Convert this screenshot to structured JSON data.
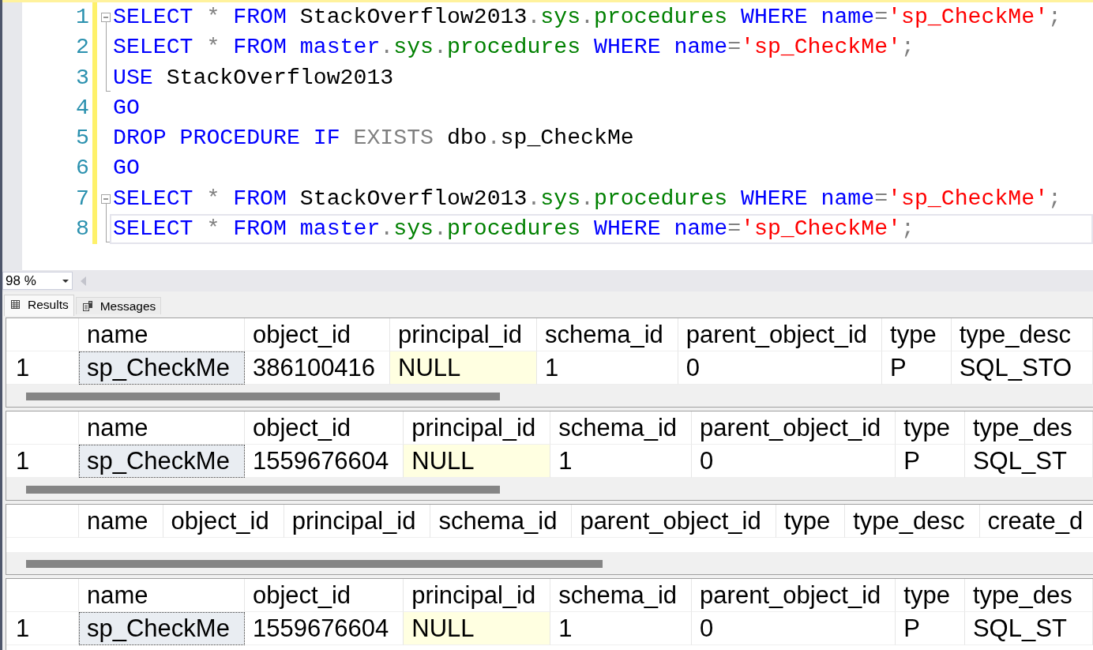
{
  "editor": {
    "lines": [
      {
        "number": "1",
        "changed": true,
        "current": false,
        "expanded": true,
        "words": [
          [
            {
              "text": "SELECT",
              "kind": "keyword"
            }
          ],
          [
            {
              "text": "*",
              "kind": "operator"
            }
          ],
          [
            {
              "text": "FROM",
              "kind": "keyword"
            }
          ],
          [
            {
              "text": "StackOverflow2013",
              "kind": "identifier"
            },
            {
              "text": ".",
              "kind": "operator"
            },
            {
              "text": "sys",
              "kind": "system"
            },
            {
              "text": ".",
              "kind": "operator"
            },
            {
              "text": "procedures",
              "kind": "system"
            }
          ],
          [
            {
              "text": "WHERE",
              "kind": "keyword"
            }
          ],
          [
            {
              "text": "name",
              "kind": "keyword"
            },
            {
              "text": "=",
              "kind": "operator"
            },
            {
              "text": "'sp_CheckMe'",
              "kind": "string"
            },
            {
              "text": ";",
              "kind": "operator"
            }
          ]
        ],
        "children": [
          {
            "number": "2",
            "changed": true,
            "current": false,
            "words": [
              [
                {
                  "text": "SELECT",
                  "kind": "keyword"
                }
              ],
              [
                {
                  "text": "*",
                  "kind": "operator"
                }
              ],
              [
                {
                  "text": "FROM",
                  "kind": "keyword"
                }
              ],
              [
                {
                  "text": "master",
                  "kind": "keyword"
                },
                {
                  "text": ".",
                  "kind": "operator"
                },
                {
                  "text": "sys",
                  "kind": "system"
                },
                {
                  "text": ".",
                  "kind": "operator"
                },
                {
                  "text": "procedures",
                  "kind": "system"
                }
              ],
              [
                {
                  "text": "WHERE",
                  "kind": "keyword"
                }
              ],
              [
                {
                  "text": "name",
                  "kind": "keyword"
                },
                {
                  "text": "=",
                  "kind": "operator"
                },
                {
                  "text": "'sp_CheckMe'",
                  "kind": "string"
                },
                {
                  "text": ";",
                  "kind": "operator"
                }
              ]
            ]
          },
          {
            "number": "3",
            "changed": true,
            "current": false,
            "words": [
              [
                {
                  "text": "USE",
                  "kind": "keyword"
                }
              ],
              [
                {
                  "text": "StackOverflow2013",
                  "kind": "identifier"
                }
              ]
            ]
          }
        ]
      },
      {
        "number": "4",
        "changed": true,
        "current": false,
        "words": [
          [
            {
              "text": "GO",
              "kind": "keyword"
            }
          ]
        ]
      },
      {
        "number": "5",
        "changed": true,
        "current": false,
        "words": [
          [
            {
              "text": "DROP",
              "kind": "keyword"
            }
          ],
          [
            {
              "text": "PROCEDURE",
              "kind": "keyword"
            }
          ],
          [
            {
              "text": "IF",
              "kind": "keyword"
            }
          ],
          [
            {
              "text": "EXISTS",
              "kind": "operator"
            }
          ],
          [
            {
              "text": "dbo",
              "kind": "identifier"
            },
            {
              "text": ".",
              "kind": "operator"
            },
            {
              "text": "sp_CheckMe",
              "kind": "identifier"
            }
          ]
        ]
      },
      {
        "number": "6",
        "changed": true,
        "current": false,
        "words": [
          [
            {
              "text": "GO",
              "kind": "keyword"
            }
          ]
        ]
      },
      {
        "number": "7",
        "changed": true,
        "current": false,
        "expanded": true,
        "words": [
          [
            {
              "text": "SELECT",
              "kind": "keyword"
            }
          ],
          [
            {
              "text": "*",
              "kind": "operator"
            }
          ],
          [
            {
              "text": "FROM",
              "kind": "keyword"
            }
          ],
          [
            {
              "text": "StackOverflow2013",
              "kind": "identifier"
            },
            {
              "text": ".",
              "kind": "operator"
            },
            {
              "text": "sys",
              "kind": "system"
            },
            {
              "text": ".",
              "kind": "operator"
            },
            {
              "text": "procedures",
              "kind": "system"
            }
          ],
          [
            {
              "text": "WHERE",
              "kind": "keyword"
            }
          ],
          [
            {
              "text": "name",
              "kind": "keyword"
            },
            {
              "text": "=",
              "kind": "operator"
            },
            {
              "text": "'sp_CheckMe'",
              "kind": "string"
            },
            {
              "text": ";",
              "kind": "operator"
            }
          ]
        ],
        "children": [
          {
            "number": "8",
            "changed": true,
            "current": true,
            "words": [
              [
                {
                  "text": "SELECT",
                  "kind": "keyword"
                }
              ],
              [
                {
                  "text": "*",
                  "kind": "operator"
                }
              ],
              [
                {
                  "text": "FROM",
                  "kind": "keyword"
                }
              ],
              [
                {
                  "text": "master",
                  "kind": "keyword"
                },
                {
                  "text": ".",
                  "kind": "operator"
                },
                {
                  "text": "sys",
                  "kind": "system"
                },
                {
                  "text": ".",
                  "kind": "operator"
                },
                {
                  "text": "procedures",
                  "kind": "system"
                }
              ],
              [
                {
                  "text": "WHERE",
                  "kind": "keyword"
                }
              ],
              [
                {
                  "text": "name",
                  "kind": "keyword"
                },
                {
                  "text": "=",
                  "kind": "operator"
                },
                {
                  "text": "'sp_CheckMe'",
                  "kind": "string"
                },
                {
                  "text": ";",
                  "kind": "operator"
                }
              ]
            ]
          }
        ]
      }
    ]
  },
  "zoom": {
    "value": "98 %"
  },
  "results": {
    "tabs": [
      {
        "label": "Results",
        "kind": "grid",
        "selected": true
      },
      {
        "label": "Messages",
        "kind": "messages",
        "selected": false
      }
    ],
    "grids": [
      {
        "columns": [
          "name",
          "object_id",
          "principal_id",
          "schema_id",
          "parent_object_id",
          "type",
          "type_desc"
        ],
        "rows": [
          {
            "number": "1",
            "cells": [
              {
                "text": "sp_CheckMe",
                "kind": "value",
                "selected": true
              },
              {
                "text": "386100416",
                "kind": "value",
                "selected": false
              },
              {
                "text": "NULL",
                "kind": "null",
                "selected": false
              },
              {
                "text": "1",
                "kind": "value",
                "selected": false
              },
              {
                "text": "0",
                "kind": "value",
                "selected": false
              },
              {
                "text": "P",
                "kind": "value",
                "selected": false
              },
              {
                "text": "SQL_STO",
                "kind": "value",
                "selected": false
              }
            ]
          }
        ]
      },
      {
        "columns": [
          "name",
          "object_id",
          "principal_id",
          "schema_id",
          "parent_object_id",
          "type",
          "type_des"
        ],
        "rows": [
          {
            "number": "1",
            "cells": [
              {
                "text": "sp_CheckMe",
                "kind": "value",
                "selected": true
              },
              {
                "text": "1559676604",
                "kind": "value",
                "selected": false
              },
              {
                "text": "NULL",
                "kind": "null",
                "selected": false
              },
              {
                "text": "1",
                "kind": "value",
                "selected": false
              },
              {
                "text": "0",
                "kind": "value",
                "selected": false
              },
              {
                "text": "P",
                "kind": "value",
                "selected": false
              },
              {
                "text": "SQL_ST",
                "kind": "value",
                "selected": false
              }
            ]
          }
        ]
      },
      {
        "columns": [
          "name",
          "object_id",
          "principal_id",
          "schema_id",
          "parent_object_id",
          "type",
          "type_desc",
          "create_d"
        ]
      },
      {
        "columns": [
          "name",
          "object_id",
          "principal_id",
          "schema_id",
          "parent_object_id",
          "type",
          "type_des"
        ],
        "rows": [
          {
            "number": "1",
            "cells": [
              {
                "text": "sp_CheckMe",
                "kind": "value",
                "selected": true
              },
              {
                "text": "1559676604",
                "kind": "value",
                "selected": false
              },
              {
                "text": "NULL",
                "kind": "null",
                "selected": false
              },
              {
                "text": "1",
                "kind": "value",
                "selected": false
              },
              {
                "text": "0",
                "kind": "value",
                "selected": false
              },
              {
                "text": "P",
                "kind": "value",
                "selected": false
              },
              {
                "text": "SQL_ST",
                "kind": "value",
                "selected": false
              }
            ]
          }
        ]
      }
    ]
  }
}
